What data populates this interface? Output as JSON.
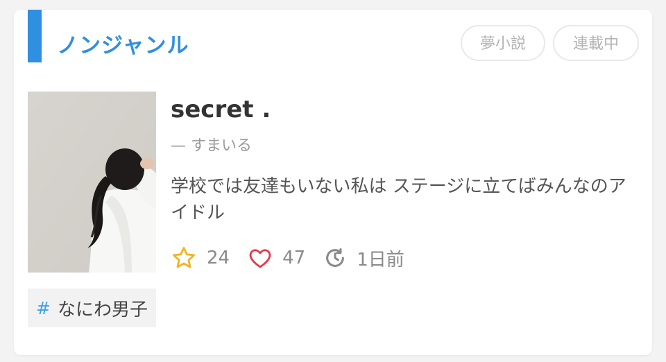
{
  "genre": {
    "label": "ノンジャンル",
    "accent_color": "#2f8fe0"
  },
  "badges": [
    "夢小説",
    "連載中"
  ],
  "story": {
    "title": "secret .",
    "author": "— すまいる",
    "description": "学校では友達もいない私は ステージに立てばみんなのアイドル",
    "stats": {
      "stars": "24",
      "likes": "47",
      "updated": "1日前"
    }
  },
  "tags": [
    {
      "hash": "#",
      "label": "なにわ男子"
    }
  ],
  "icons": {
    "star": "star-icon",
    "heart": "heart-icon",
    "clock": "clock-icon"
  }
}
